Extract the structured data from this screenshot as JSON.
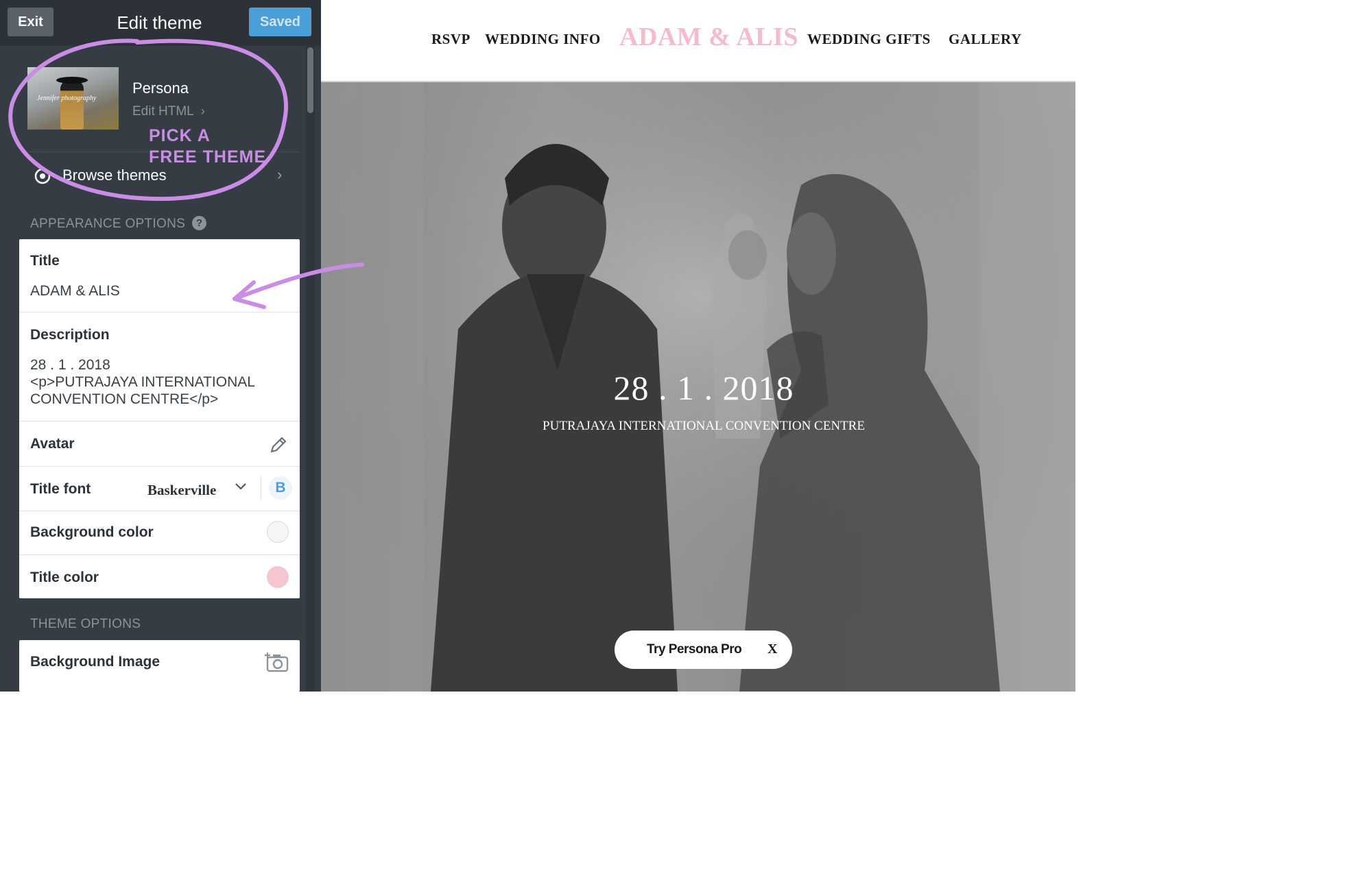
{
  "editor": {
    "exit_label": "Exit",
    "title": "Edit theme",
    "saved_label": "Saved",
    "theme": {
      "name": "Persona",
      "edit_html_label": "Edit HTML",
      "thumbnail_caption": "Jennifer photography"
    },
    "browse_label": "Browse themes",
    "appearance_heading": "APPEARANCE OPTIONS",
    "help_glyph": "?",
    "options": {
      "title_label": "Title",
      "title_value": "ADAM & ALIS",
      "description_label": "Description",
      "description_lines": [
        "28 . 1 . 2018",
        "<p>PUTRAJAYA INTERNATIONAL",
        "CONVENTION CENTRE</p>"
      ],
      "avatar_label": "Avatar",
      "title_font_label": "Title font",
      "title_font_value": "Baskerville",
      "bold_glyph": "B",
      "bg_color_label": "Background color",
      "bg_color_value": "#f5f5f5",
      "title_color_label": "Title color",
      "title_color_value": "#f7c5d0"
    },
    "theme_options_heading": "THEME OPTIONS",
    "background_image_label": "Background Image"
  },
  "annotation": {
    "text_lines": [
      "PICK A",
      "FREE THEME"
    ],
    "color": "#c98de6"
  },
  "preview": {
    "nav": {
      "rsvp": "RSVP",
      "wedding_info": "WEDDING INFO",
      "site_title": "ADAM & ALIS",
      "wedding_gifts": "WEDDING GIFTS",
      "gallery": "GALLERY"
    },
    "hero": {
      "date": "28 . 1 . 2018",
      "venue": "PUTRAJAYA INTERNATIONAL CONVENTION CENTRE"
    },
    "pro_banner": {
      "label": "Try Persona Pro",
      "close": "X"
    }
  },
  "colors": {
    "panel_bg": "#353c44",
    "accent_blue": "#4a9fd8",
    "title_pink": "#f4bccb"
  }
}
